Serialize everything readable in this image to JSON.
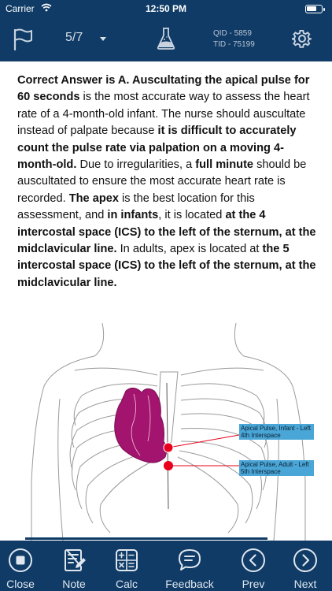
{
  "status": {
    "carrier": "Carrier",
    "time": "12:50 PM"
  },
  "header": {
    "counter": "5/7",
    "qid": "QID - 5859",
    "tid": "TID - 75199"
  },
  "answer": {
    "s1": "Correct Answer is A. Auscultating the apical pulse for 60 seconds",
    "s2": " is the most accurate way to assess the heart rate of a 4-month-old infant. The nurse should auscultate instead of palpate because ",
    "s3": "it is difficult to accurately count the pulse rate via palpation on a moving 4-month-old.",
    "s4": " Due to irregularities, a ",
    "s5": "full minute",
    "s6": " should be auscultated to ensure the most accurate heart rate is recorded. ",
    "s7": "The apex",
    "s8": " is the best location for this assessment, and ",
    "s9": "in infants",
    "s10": ", it is located ",
    "s11": "at the 4 intercostal space (ICS) to the left of the sternum, at the midclavicular line.",
    "s12": " In adults, apex is located at ",
    "s13": "the 5 intercostal space (ICS) to the left of the sternum, at the midclavicular line."
  },
  "figure": {
    "label_infant": "Apical Pulse, Infant - Left 4th Interspace",
    "label_adult": "Apical Pulse, Adult - Left 5th Interspace",
    "heart_color": "#a3146e",
    "marker_color": "#e8001c"
  },
  "tabs": [
    {
      "label": "Close",
      "icon": "stop-circle-icon"
    },
    {
      "label": "Note",
      "icon": "note-icon"
    },
    {
      "label": "Calc",
      "icon": "calculator-icon"
    },
    {
      "label": "Feedback",
      "icon": "chat-bubble-icon"
    },
    {
      "label": "Prev",
      "icon": "chevron-left-circle-icon"
    },
    {
      "label": "Next",
      "icon": "chevron-right-circle-icon"
    }
  ]
}
